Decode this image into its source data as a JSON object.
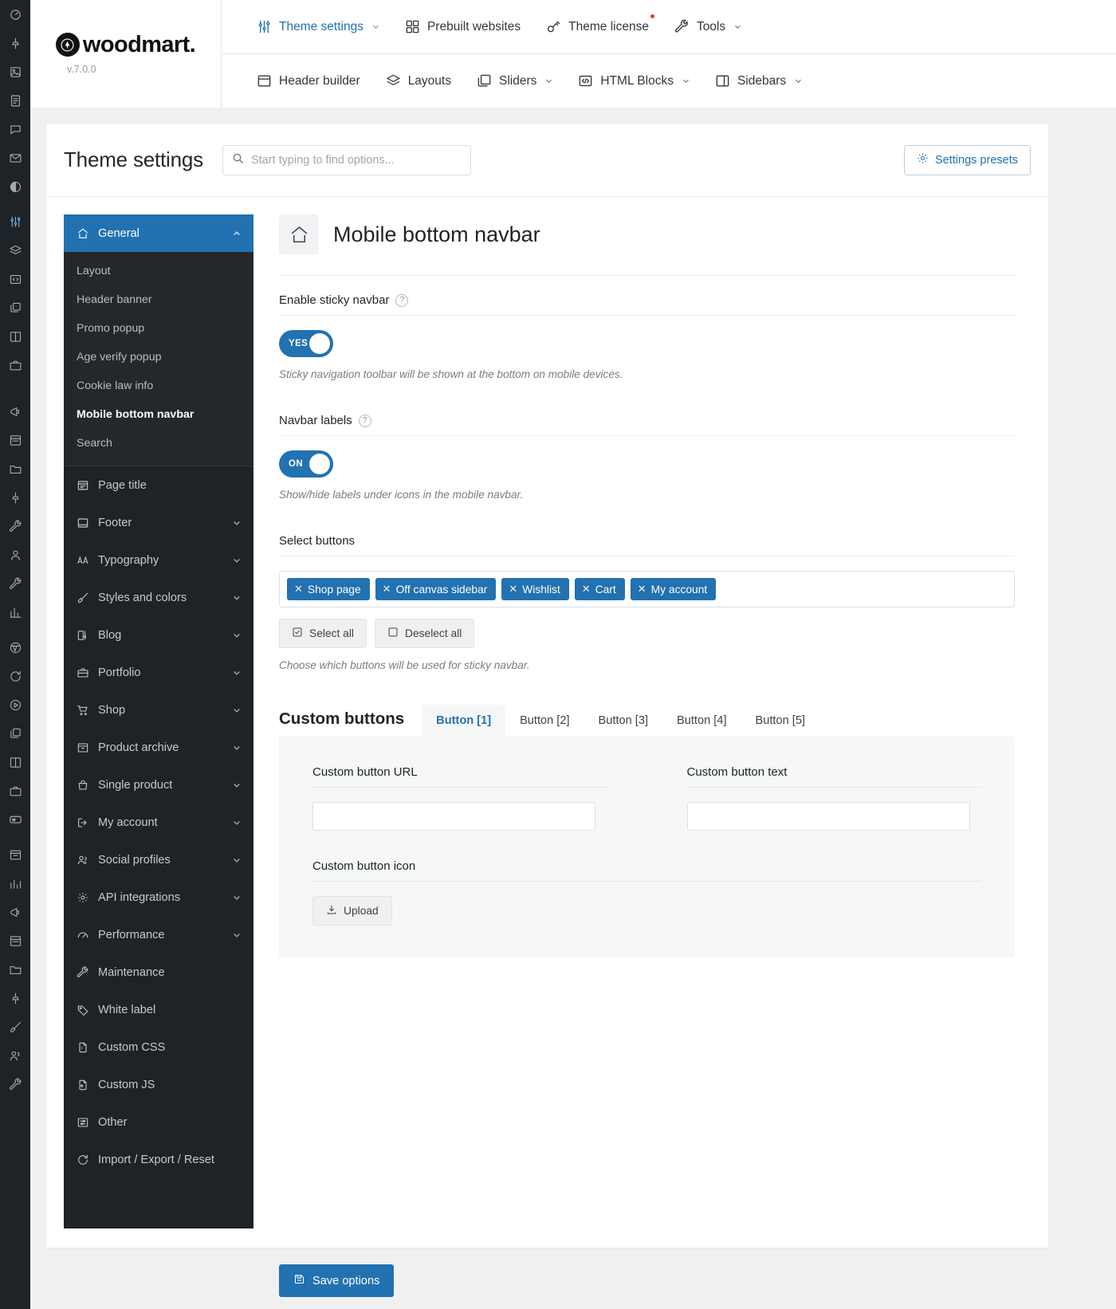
{
  "rail": {
    "icons": [
      {
        "name": "dashboard-icon",
        "active": false
      },
      {
        "name": "pin-icon",
        "active": false
      },
      {
        "name": "media-icon",
        "active": false
      },
      {
        "name": "pages-icon",
        "active": false
      },
      {
        "name": "comments-icon",
        "active": false
      },
      {
        "name": "mail-icon",
        "active": false
      },
      {
        "name": "contrast-icon",
        "active": false
      },
      {
        "name": "sliders-icon",
        "active": true
      },
      {
        "name": "layers-icon",
        "active": false
      },
      {
        "name": "code-icon",
        "active": false
      },
      {
        "name": "copy-icon",
        "active": false
      },
      {
        "name": "columns-icon",
        "active": false
      },
      {
        "name": "briefcase-icon",
        "active": false
      },
      {
        "name": "megaphone-icon",
        "active": false
      },
      {
        "name": "list-icon",
        "active": false
      },
      {
        "name": "folder-icon",
        "active": false
      },
      {
        "name": "pin2-icon",
        "active": false
      },
      {
        "name": "plug-icon",
        "active": false
      },
      {
        "name": "user-icon",
        "active": false
      },
      {
        "name": "wrench-icon",
        "active": false
      },
      {
        "name": "chart-icon",
        "active": false
      },
      {
        "name": "wordpress-icon",
        "active": false
      },
      {
        "name": "refresh-icon",
        "active": false
      },
      {
        "name": "play-icon",
        "active": false
      },
      {
        "name": "copy2-icon",
        "active": false
      },
      {
        "name": "columns2-icon",
        "active": false
      },
      {
        "name": "briefcase2-icon",
        "active": false
      },
      {
        "name": "woo-icon",
        "active": false
      },
      {
        "name": "archive-icon",
        "active": false
      },
      {
        "name": "analytics-icon",
        "active": false
      },
      {
        "name": "marketing-icon",
        "active": false
      },
      {
        "name": "list2-icon",
        "active": false
      },
      {
        "name": "folder2-icon",
        "active": false
      },
      {
        "name": "pin3-icon",
        "active": false
      },
      {
        "name": "brush-icon",
        "active": false
      },
      {
        "name": "users-icon",
        "active": false
      },
      {
        "name": "tools-icon",
        "active": false
      }
    ]
  },
  "brand": {
    "name": "woodmart.",
    "version": "v.7.0.0"
  },
  "topnav": {
    "row1": [
      {
        "label": "Theme settings",
        "icon": "sliders-icon",
        "caret": true,
        "accent": true,
        "dot": false
      },
      {
        "label": "Prebuilt websites",
        "icon": "grid-icon",
        "caret": false,
        "accent": false,
        "dot": false
      },
      {
        "label": "Theme license",
        "icon": "key-icon",
        "caret": false,
        "accent": false,
        "dot": true
      },
      {
        "label": "Tools",
        "icon": "wrench-icon",
        "caret": true,
        "accent": false,
        "dot": false
      }
    ],
    "row2": [
      {
        "label": "Header builder",
        "icon": "window-icon",
        "caret": false
      },
      {
        "label": "Layouts",
        "icon": "layers-icon",
        "caret": false
      },
      {
        "label": "Sliders",
        "icon": "slides-icon",
        "caret": true
      },
      {
        "label": "HTML Blocks",
        "icon": "code-icon",
        "caret": true
      },
      {
        "label": "Sidebars",
        "icon": "sidebar-icon",
        "caret": true
      }
    ]
  },
  "header": {
    "title": "Theme settings",
    "search_placeholder": "Start typing to find options...",
    "presets_label": "Settings presets"
  },
  "sidebar": {
    "group": {
      "label": "General",
      "icon": "home-icon",
      "active": true,
      "children": [
        {
          "label": "Layout",
          "current": false
        },
        {
          "label": "Header banner",
          "current": false
        },
        {
          "label": "Promo popup",
          "current": false
        },
        {
          "label": "Age verify popup",
          "current": false
        },
        {
          "label": "Cookie law info",
          "current": false
        },
        {
          "label": "Mobile bottom navbar",
          "current": true
        },
        {
          "label": "Search",
          "current": false
        }
      ]
    },
    "items": [
      {
        "label": "Page title",
        "icon": "pagetitle-icon",
        "caret": false
      },
      {
        "label": "Footer",
        "icon": "footer-icon",
        "caret": true
      },
      {
        "label": "Typography",
        "icon": "typography-icon",
        "caret": true
      },
      {
        "label": "Styles and colors",
        "icon": "brush-icon",
        "caret": true
      },
      {
        "label": "Blog",
        "icon": "blog-icon",
        "caret": true
      },
      {
        "label": "Portfolio",
        "icon": "portfolio-icon",
        "caret": true
      },
      {
        "label": "Shop",
        "icon": "cart-icon",
        "caret": true
      },
      {
        "label": "Product archive",
        "icon": "archive-icon",
        "caret": true
      },
      {
        "label": "Single product",
        "icon": "bag-icon",
        "caret": true
      },
      {
        "label": "My account",
        "icon": "login-icon",
        "caret": true
      },
      {
        "label": "Social profiles",
        "icon": "users-icon",
        "caret": true
      },
      {
        "label": "API integrations",
        "icon": "gear-icon",
        "caret": true
      },
      {
        "label": "Performance",
        "icon": "gauge-icon",
        "caret": true
      },
      {
        "label": "Maintenance",
        "icon": "wrench-icon",
        "caret": false
      },
      {
        "label": "White label",
        "icon": "tag-icon",
        "caret": false
      },
      {
        "label": "Custom CSS",
        "icon": "file-css-icon",
        "caret": false
      },
      {
        "label": "Custom JS",
        "icon": "file-js-icon",
        "caret": false
      },
      {
        "label": "Other",
        "icon": "options-icon",
        "caret": false
      },
      {
        "label": "Import / Export / Reset",
        "icon": "import-export-icon",
        "caret": false
      }
    ]
  },
  "option_page": {
    "icon": "home-icon",
    "title": "Mobile bottom navbar",
    "fields": {
      "sticky": {
        "label": "Enable sticky navbar",
        "toggle_value": "YES",
        "description": "Sticky navigation toolbar will be shown at the bottom on mobile devices."
      },
      "labels": {
        "label": "Navbar labels",
        "toggle_value": "ON",
        "description": "Show/hide labels under icons in the mobile navbar."
      },
      "select_buttons": {
        "label": "Select buttons",
        "tags": [
          "Shop page",
          "Off canvas sidebar",
          "Wishlist",
          "Cart",
          "My account"
        ],
        "select_all_label": "Select all",
        "deselect_all_label": "Deselect all",
        "description": "Choose which buttons will be used for sticky navbar."
      }
    },
    "custom_buttons": {
      "title": "Custom buttons",
      "tabs": [
        {
          "label": "Button [1]",
          "active": true
        },
        {
          "label": "Button [2]",
          "active": false
        },
        {
          "label": "Button [3]",
          "active": false
        },
        {
          "label": "Button [4]",
          "active": false
        },
        {
          "label": "Button [5]",
          "active": false
        }
      ],
      "url_label": "Custom button URL",
      "url_value": "",
      "text_label": "Custom button text",
      "text_value": "",
      "icon_label": "Custom button icon",
      "upload_label": "Upload"
    },
    "save_label": "Save options"
  },
  "colors": {
    "accent": "#2271b1",
    "sidebar_bg": "#1e2327",
    "rail_bg": "#1d2327",
    "pane_bg": "#f6f7f7"
  }
}
